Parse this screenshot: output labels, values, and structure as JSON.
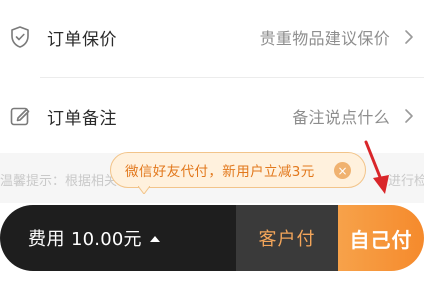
{
  "rows": {
    "insurance": {
      "label": "订单保价",
      "value": "贵重物品建议保价",
      "icon": "shield-icon"
    },
    "remark": {
      "label": "订单备注",
      "value": "备注说点什么",
      "icon": "edit-icon"
    }
  },
  "notice": {
    "text": "温馨提示：根据相关",
    "tail": "进行检"
  },
  "tooltip": {
    "text": "微信好友代付，新用户立减3元",
    "close": "×"
  },
  "bar": {
    "fee_label": "费用",
    "fee_amount": "10.00元",
    "customer_pay": "客户付",
    "self_pay": "自己付"
  },
  "colors": {
    "accent": "#f58a2c",
    "tooltip_text": "#e2781c",
    "dark_bar": "#1e1e1e",
    "annotation_arrow": "#d9262a"
  }
}
